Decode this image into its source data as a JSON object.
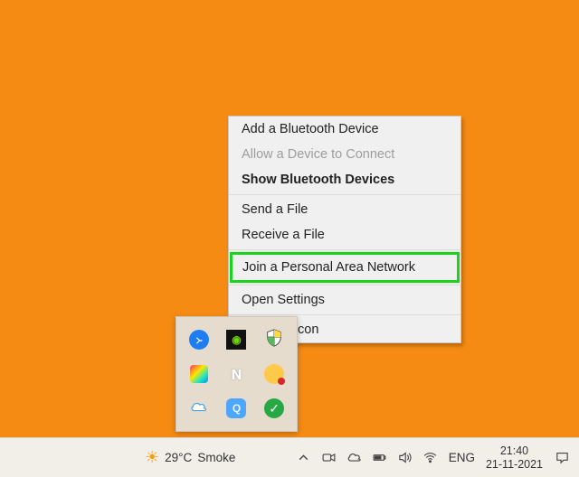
{
  "context_menu": {
    "add_device": "Add a Bluetooth Device",
    "allow_connect": "Allow a Device to Connect",
    "show_devices": "Show Bluetooth Devices",
    "send_file": "Send a File",
    "receive_file": "Receive a File",
    "join_pan": "Join a Personal Area Network",
    "open_settings": "Open Settings",
    "remove_icon": "Remove Icon"
  },
  "tray": {
    "icons": [
      "bluetooth-icon",
      "nvidia-icon",
      "security-shield-icon",
      "color-picker-icon",
      "notion-icon",
      "lock-icon",
      "onedrive-icon",
      "audio-app-icon",
      "checkmark-icon"
    ]
  },
  "taskbar": {
    "weather_temp": "29°C",
    "weather_label": "Smoke",
    "ime": "ENG",
    "time": "21:40",
    "date": "21-11-2021"
  }
}
